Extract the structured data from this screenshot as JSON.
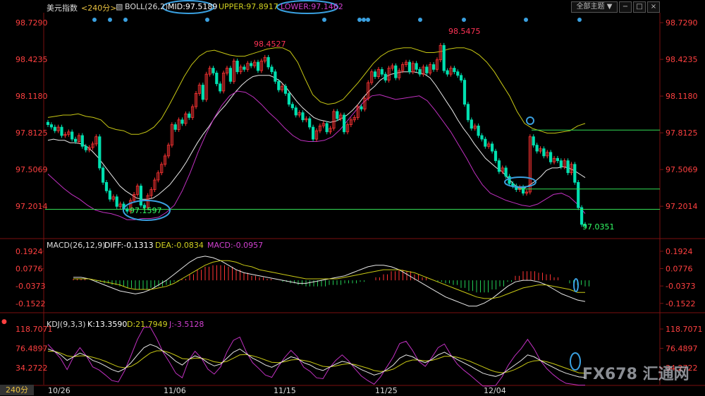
{
  "header": {
    "symbol": "美元指数",
    "period_tag": "<240分>",
    "boll_label": "BOLL(26,2)",
    "mid_label": "MID:97.5189",
    "upper_label": "UPPER:97.8917",
    "lower_label": "LOWER:97.1462",
    "theme_button": "全部主题",
    "window_buttons": [
      "−",
      "□",
      "×"
    ]
  },
  "macd_header": {
    "title": "MACD(26,12,9)",
    "diff": "DIFF:-0.1313",
    "dea": "DEA:-0.0834",
    "macd": "MACD:-0.0957"
  },
  "kdj_header": {
    "title": "KDJ(9,3,3)",
    "k": "K:13.3590",
    "d": "D:21.7949",
    "j": "J:-3.5128"
  },
  "period_badge": "240分",
  "watermark": "FX678 汇通网",
  "colors": {
    "up": "#ff3333",
    "down": "#00e0b0",
    "mid": "#e8e8e8",
    "upper": "#c8c814",
    "lower": "#c030c0",
    "annotation": "#3aa0e0",
    "price_label": "#ff3355",
    "low_label": "#33ff66",
    "hline": "#33dd55"
  },
  "chart_data": {
    "type": "candlestick",
    "price": {
      "ylim": [
        96.95,
        98.8
      ],
      "y_ticks": [
        "98.7290",
        "98.4235",
        "98.1180",
        "97.8125",
        "97.5069",
        "97.2014"
      ],
      "candles_close": [
        97.88,
        97.86,
        97.83,
        97.86,
        97.79,
        97.8,
        97.82,
        97.76,
        97.74,
        97.79,
        97.7,
        97.67,
        97.69,
        97.72,
        97.78,
        97.52,
        97.4,
        97.33,
        97.26,
        97.28,
        97.2,
        97.22,
        97.18,
        97.16,
        97.25,
        97.3,
        97.37,
        97.21,
        97.19,
        97.29,
        97.34,
        97.42,
        97.48,
        97.55,
        97.62,
        97.71,
        97.88,
        97.84,
        97.92,
        97.89,
        97.97,
        97.94,
        98.03,
        98.14,
        98.21,
        98.09,
        98.3,
        98.35,
        98.31,
        98.22,
        98.16,
        98.31,
        98.35,
        98.24,
        98.41,
        98.32,
        98.36,
        98.34,
        98.39,
        98.37,
        98.4,
        98.33,
        98.41,
        98.44,
        98.36,
        98.32,
        98.24,
        98.17,
        98.2,
        98.14,
        98.05,
        98.02,
        97.96,
        97.98,
        97.92,
        97.93,
        97.86,
        97.76,
        97.83,
        97.87,
        97.89,
        97.82,
        97.85,
        97.99,
        97.93,
        97.96,
        97.82,
        97.88,
        97.92,
        97.94,
        98.03,
        98.01,
        98.1,
        98.23,
        98.32,
        98.28,
        98.34,
        98.3,
        98.25,
        98.35,
        98.37,
        98.27,
        98.33,
        98.38,
        98.4,
        98.32,
        98.39,
        98.34,
        98.3,
        98.36,
        98.31,
        98.38,
        98.34,
        98.42,
        98.54,
        98.33,
        98.3,
        98.35,
        98.32,
        98.29,
        98.25,
        98.05,
        97.92,
        97.85,
        97.87,
        97.79,
        97.76,
        97.7,
        97.72,
        97.66,
        97.58,
        97.49,
        97.52,
        97.45,
        97.39,
        97.37,
        97.34,
        97.36,
        97.31,
        97.32,
        97.78,
        97.71,
        97.66,
        97.68,
        97.62,
        97.65,
        97.57,
        97.6,
        97.58,
        97.53,
        97.58,
        97.48,
        97.55,
        97.4,
        97.19,
        97.05,
        97.04
      ],
      "mid": [
        97.75,
        97.76,
        97.75,
        97.75,
        97.73,
        97.73,
        97.72,
        97.7,
        97.66,
        97.61,
        97.55,
        97.49,
        97.43,
        97.37,
        97.33,
        97.3,
        97.27,
        97.26,
        97.26,
        97.27,
        97.3,
        97.34,
        97.38,
        97.44,
        97.5,
        97.57,
        97.65,
        97.73,
        97.8,
        97.86,
        97.93,
        97.99,
        98.04,
        98.1,
        98.16,
        98.21,
        98.25,
        98.28,
        98.29,
        98.29,
        98.29,
        98.27,
        98.24,
        98.19,
        98.13,
        98.07,
        98.02,
        97.98,
        97.94,
        97.92,
        97.91,
        97.9,
        97.91,
        97.93,
        97.96,
        98.0,
        98.05,
        98.11,
        98.16,
        98.2,
        98.25,
        98.28,
        98.3,
        98.31,
        98.32,
        98.32,
        98.32,
        98.31,
        98.3,
        98.27,
        98.21,
        98.14,
        98.07,
        98.0,
        97.92,
        97.85,
        97.79,
        97.72,
        97.66,
        97.6,
        97.56,
        97.52,
        97.49,
        97.44,
        97.39,
        97.35,
        97.35,
        97.38,
        97.41,
        97.45,
        97.5,
        97.52,
        97.52,
        97.53,
        97.52,
        97.5,
        97.47,
        97.44
      ],
      "upper": [
        97.94,
        97.95,
        97.96,
        97.96,
        97.97,
        97.95,
        97.94,
        97.92,
        97.86,
        97.84,
        97.83,
        97.8,
        97.8,
        97.82,
        97.86,
        97.93,
        98.04,
        98.16,
        98.28,
        98.38,
        98.45,
        98.49,
        98.5,
        98.48,
        98.46,
        98.45,
        98.45,
        98.47,
        98.49,
        98.51,
        98.52,
        98.52,
        98.49,
        98.4,
        98.26,
        98.13,
        98.07,
        98.05,
        98.06,
        98.09,
        98.16,
        98.23,
        98.31,
        98.39,
        98.45,
        98.49,
        98.51,
        98.52,
        98.52,
        98.5,
        98.48,
        98.48,
        98.49,
        98.51,
        98.52,
        98.52,
        98.5,
        98.46,
        98.4,
        98.32,
        98.22,
        98.12,
        97.99,
        97.89,
        97.85,
        97.83,
        97.81,
        97.81,
        97.82,
        97.83,
        97.87,
        97.89
      ],
      "lower": [
        97.47,
        97.41,
        97.35,
        97.3,
        97.26,
        97.21,
        97.17,
        97.15,
        97.14,
        97.12,
        97.09,
        97.09,
        97.1,
        97.1,
        97.11,
        97.15,
        97.21,
        97.33,
        97.48,
        97.65,
        97.8,
        97.93,
        98.04,
        98.12,
        98.16,
        98.15,
        98.11,
        98.05,
        97.98,
        97.92,
        97.85,
        97.79,
        97.75,
        97.74,
        97.74,
        97.75,
        97.78,
        97.84,
        97.92,
        98.0,
        98.07,
        98.12,
        98.13,
        98.11,
        98.09,
        98.1,
        98.11,
        98.12,
        98.08,
        98.0,
        97.91,
        97.82,
        97.71,
        97.6,
        97.48,
        97.38,
        97.31,
        97.28,
        97.25,
        97.23,
        97.21,
        97.2,
        97.22,
        97.26,
        97.3,
        97.31,
        97.28,
        97.22,
        97.14
      ]
    },
    "annotations": [
      {
        "text": "98.4527",
        "type": "high",
        "ref": "price_high_1"
      },
      {
        "text": "98.5475",
        "type": "high",
        "ref": "price_high_2"
      },
      {
        "text": "97.1597",
        "type": "low",
        "ref": "price_low_1"
      },
      {
        "text": "97.0351",
        "type": "low",
        "ref": "price_low_2"
      }
    ],
    "hlines": [
      97.835,
      97.345,
      97.176
    ],
    "macd": {
      "ylim": [
        -0.2,
        0.22
      ],
      "y_ticks": [
        "0.1924",
        "0.0776",
        "-0.0373",
        "-0.1522"
      ],
      "hist": [
        0.01,
        0.01,
        0.0,
        -0.01,
        -0.02,
        -0.03,
        -0.04,
        -0.05,
        -0.06,
        -0.06,
        -0.05,
        -0.04,
        -0.03,
        -0.01,
        0.01,
        0.04,
        0.07,
        0.09,
        0.1,
        0.1,
        0.09,
        0.07,
        0.05,
        0.03,
        0.02,
        0.01,
        0.0,
        -0.01,
        -0.02,
        -0.03,
        -0.04,
        -0.04,
        -0.04,
        -0.03,
        -0.03,
        -0.02,
        -0.02,
        -0.01,
        0.0,
        0.02,
        0.04,
        0.06,
        0.07,
        0.06,
        0.04,
        0.02,
        0.0,
        -0.01,
        -0.02,
        -0.03,
        -0.05,
        -0.07,
        -0.08,
        -0.08,
        -0.06,
        -0.04,
        -0.01,
        0.03,
        0.06,
        0.06,
        0.05,
        0.04,
        0.02,
        0.0,
        -0.02,
        -0.03,
        -0.04
      ],
      "diff": [
        0.02,
        0.02,
        0.01,
        -0.01,
        -0.03,
        -0.05,
        -0.07,
        -0.08,
        -0.09,
        -0.08,
        -0.06,
        -0.03,
        0.0,
        0.04,
        0.08,
        0.12,
        0.15,
        0.16,
        0.15,
        0.13,
        0.1,
        0.07,
        0.05,
        0.04,
        0.03,
        0.02,
        0.01,
        0.0,
        -0.01,
        -0.02,
        -0.02,
        -0.01,
        0.0,
        0.01,
        0.02,
        0.03,
        0.05,
        0.07,
        0.09,
        0.1,
        0.1,
        0.09,
        0.07,
        0.04,
        0.01,
        -0.02,
        -0.05,
        -0.08,
        -0.11,
        -0.13,
        -0.15,
        -0.17,
        -0.17,
        -0.15,
        -0.12,
        -0.08,
        -0.04,
        -0.01,
        0.0,
        0.0,
        -0.01,
        -0.03,
        -0.06,
        -0.09,
        -0.11,
        -0.13,
        -0.14
      ],
      "dea": [
        0.01,
        0.01,
        0.01,
        0.0,
        -0.01,
        -0.02,
        -0.03,
        -0.05,
        -0.06,
        -0.06,
        -0.06,
        -0.05,
        -0.04,
        -0.02,
        0.01,
        0.04,
        0.07,
        0.1,
        0.12,
        0.13,
        0.13,
        0.12,
        0.1,
        0.09,
        0.07,
        0.06,
        0.05,
        0.04,
        0.03,
        0.02,
        0.01,
        0.01,
        0.01,
        0.01,
        0.01,
        0.02,
        0.03,
        0.04,
        0.05,
        0.06,
        0.07,
        0.07,
        0.07,
        0.06,
        0.05,
        0.03,
        0.01,
        -0.01,
        -0.03,
        -0.05,
        -0.07,
        -0.09,
        -0.11,
        -0.12,
        -0.12,
        -0.11,
        -0.09,
        -0.07,
        -0.05,
        -0.04,
        -0.03,
        -0.03,
        -0.04,
        -0.05,
        -0.06,
        -0.08,
        -0.08
      ]
    },
    "kdj": {
      "ylim": [
        0,
        125
      ],
      "y_ticks": [
        "118.7071",
        "76.4897",
        "34.2722"
      ],
      "k": [
        75,
        70,
        62,
        50,
        58,
        66,
        60,
        50,
        45,
        38,
        30,
        25,
        32,
        45,
        62,
        78,
        85,
        80,
        70,
        60,
        48,
        40,
        52,
        60,
        55,
        45,
        38,
        42,
        55,
        68,
        75,
        65,
        55,
        48,
        40,
        35,
        42,
        50,
        58,
        54,
        45,
        40,
        32,
        28,
        35,
        42,
        48,
        45,
        38,
        30,
        24,
        18,
        22,
        30,
        40,
        55,
        62,
        58,
        50,
        45,
        52,
        62,
        68,
        60,
        52,
        45,
        38,
        30,
        22,
        18,
        15,
        20,
        30,
        40,
        50,
        62,
        58,
        50,
        42,
        35,
        28,
        22,
        18,
        14,
        13
      ],
      "d": [
        70,
        70,
        66,
        60,
        58,
        60,
        60,
        57,
        53,
        48,
        42,
        36,
        34,
        37,
        45,
        56,
        66,
        71,
        71,
        67,
        61,
        54,
        53,
        55,
        55,
        52,
        47,
        45,
        48,
        55,
        62,
        63,
        60,
        56,
        51,
        46,
        45,
        47,
        51,
        52,
        50,
        47,
        42,
        37,
        36,
        38,
        41,
        43,
        41,
        37,
        33,
        28,
        26,
        27,
        31,
        39,
        47,
        51,
        51,
        49,
        50,
        54,
        59,
        59,
        57,
        53,
        48,
        42,
        36,
        30,
        25,
        23,
        25,
        30,
        37,
        45,
        49,
        50,
        47,
        43,
        38,
        33,
        28,
        23,
        22
      ],
      "j": [
        85,
        70,
        54,
        30,
        58,
        78,
        60,
        36,
        29,
        18,
        6,
        3,
        28,
        61,
        96,
        122,
        123,
        98,
        68,
        46,
        22,
        12,
        50,
        70,
        55,
        31,
        20,
        36,
        69,
        94,
        101,
        69,
        45,
        32,
        18,
        13,
        36,
        56,
        72,
        58,
        35,
        26,
        12,
        10,
        33,
        50,
        62,
        49,
        32,
        16,
        6,
        -2,
        14,
        36,
        58,
        87,
        92,
        72,
        48,
        37,
        56,
        78,
        86,
        62,
        42,
        29,
        18,
        6,
        -6,
        -6,
        -5,
        14,
        40,
        60,
        76,
        96,
        76,
        50,
        32,
        19,
        8,
        0,
        -2,
        -4,
        -4
      ]
    },
    "x_ticks": [
      "10/26",
      "11/06",
      "11/15",
      "11/25",
      "12/04"
    ]
  }
}
